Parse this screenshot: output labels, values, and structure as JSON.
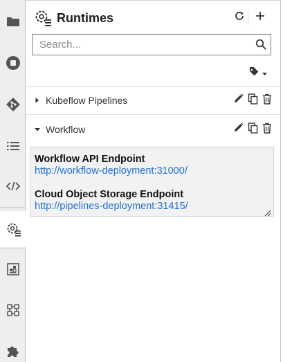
{
  "panel": {
    "title": "Runtimes",
    "refresh_icon": "refresh-icon",
    "add_icon": "add-icon"
  },
  "search": {
    "placeholder": "Search...",
    "value": ""
  },
  "tag_filter": {
    "icon": "tag-icon"
  },
  "activity_bar": {
    "items": [
      {
        "name": "file-browser",
        "icon": "folder-icon"
      },
      {
        "name": "running-terminals",
        "icon": "stop-circle-icon"
      },
      {
        "name": "git",
        "icon": "git-icon"
      },
      {
        "name": "table-of-contents",
        "icon": "list-icon"
      },
      {
        "name": "code-snippets",
        "icon": "code-icon"
      },
      {
        "name": "runtimes",
        "icon": "runtimes-icon",
        "active": true
      },
      {
        "name": "runtime-images",
        "icon": "runtime-images-icon"
      },
      {
        "name": "component-catalogs",
        "icon": "component-catalog-icon"
      },
      {
        "name": "extensions",
        "icon": "puzzle-icon"
      }
    ]
  },
  "runtimes": [
    {
      "name": "Kubeflow Pipelines",
      "expanded": false
    },
    {
      "name": "Workflow",
      "expanded": true,
      "details": {
        "api_label": "Workflow API Endpoint",
        "api_value": "http://workflow-deployment:31000/",
        "cos_label": "Cloud Object Storage Endpoint",
        "cos_value": "http://pipelines-deployment:31415/"
      }
    }
  ],
  "colors": {
    "link": "#1f6fd1",
    "activity_bar_bg": "#eeeeee",
    "details_bg": "#f2f2f2"
  }
}
